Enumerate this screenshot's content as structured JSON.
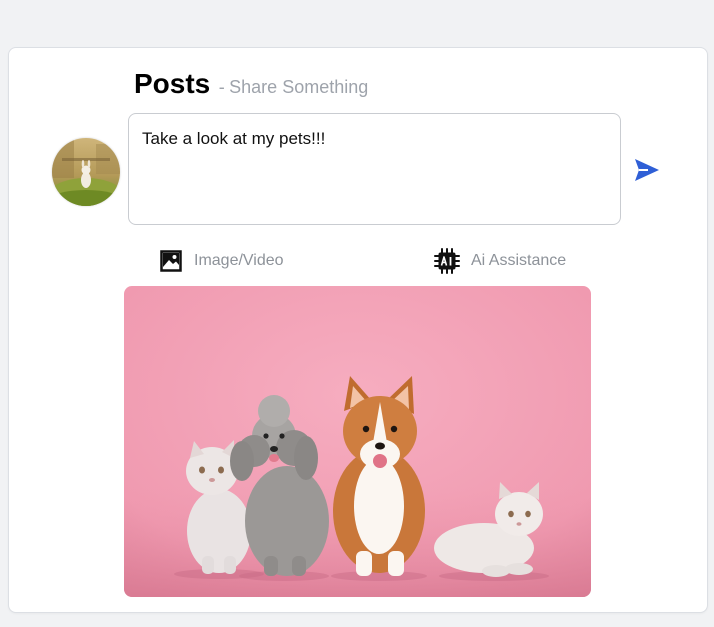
{
  "post": {
    "title": "Posts",
    "separator": "-",
    "subtitle": "Share Something",
    "input_value": "Take a look at my pets!!!",
    "actions": {
      "image_video": {
        "label": "Image/Video",
        "icon": "image-icon"
      },
      "ai_assistance": {
        "label": "Ai Assistance",
        "icon": "ai-chip-icon"
      }
    },
    "send_icon": "send-icon",
    "avatar_icon": "user-avatar-photo"
  },
  "colors": {
    "accent": "#2f5fd6",
    "muted_text": "#8d9299",
    "photo_background": "#f2a3b6"
  }
}
